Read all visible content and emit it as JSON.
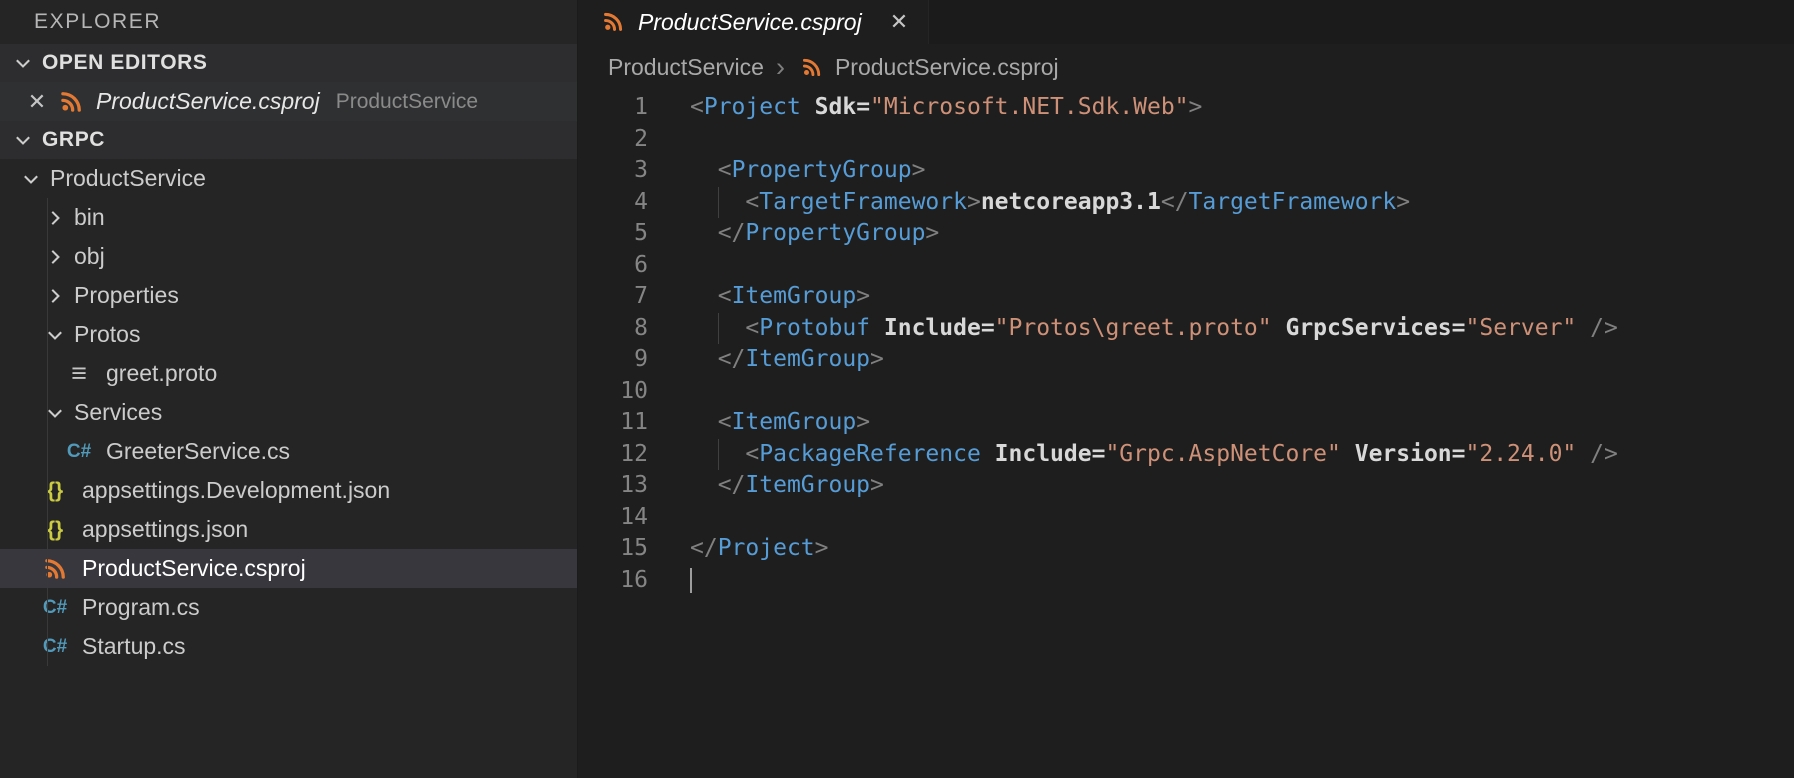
{
  "colors": {
    "accent_orange": "#e37933",
    "csharp_blue": "#519aba",
    "json_yellow": "#cbcb41",
    "tag_blue": "#569cd6",
    "string_orange": "#ce9178",
    "selection_bg": "#37373d"
  },
  "sidebar": {
    "title": "EXPLORER",
    "open_editors": {
      "header": "OPEN EDITORS",
      "items": [
        {
          "close": "✕",
          "icon": "csproj",
          "label": "ProductService.csproj",
          "description": "ProductService"
        }
      ]
    },
    "workspace": {
      "header": "GRPC",
      "tree": [
        {
          "label": "ProductService",
          "indent": 0,
          "kind": "folder",
          "expanded": true
        },
        {
          "label": "bin",
          "indent": 1,
          "kind": "folder",
          "expanded": false
        },
        {
          "label": "obj",
          "indent": 1,
          "kind": "folder",
          "expanded": false
        },
        {
          "label": "Properties",
          "indent": 1,
          "kind": "folder",
          "expanded": false
        },
        {
          "label": "Protos",
          "indent": 1,
          "kind": "folder",
          "expanded": true
        },
        {
          "label": "greet.proto",
          "indent": 2,
          "kind": "file",
          "icon": "proto"
        },
        {
          "label": "Services",
          "indent": 1,
          "kind": "folder",
          "expanded": true
        },
        {
          "label": "GreeterService.cs",
          "indent": 2,
          "kind": "file",
          "icon": "csharp"
        },
        {
          "label": "appsettings.Development.json",
          "indent": 1,
          "kind": "file",
          "icon": "json"
        },
        {
          "label": "appsettings.json",
          "indent": 1,
          "kind": "file",
          "icon": "json"
        },
        {
          "label": "ProductService.csproj",
          "indent": 1,
          "kind": "file",
          "icon": "csproj",
          "selected": true
        },
        {
          "label": "Program.cs",
          "indent": 1,
          "kind": "file",
          "icon": "csharp"
        },
        {
          "label": "Startup.cs",
          "indent": 1,
          "kind": "file",
          "icon": "csharp"
        }
      ]
    }
  },
  "editor": {
    "tab": {
      "label": "ProductService.csproj",
      "icon": "csproj",
      "close": "✕",
      "preview": true
    },
    "breadcrumb_separator": "›",
    "breadcrumb": [
      {
        "label": "ProductService"
      },
      {
        "label": "ProductService.csproj",
        "icon": "csproj"
      }
    ],
    "lines": [
      {
        "tokens": [
          [
            "p",
            "<"
          ],
          [
            "t",
            "Project"
          ],
          [
            "w",
            " "
          ],
          [
            "a",
            "Sdk="
          ],
          [
            "s",
            "\"Microsoft.NET.Sdk.Web\""
          ],
          [
            "p",
            ">"
          ]
        ]
      },
      {
        "tokens": []
      },
      {
        "tokens": [
          [
            "w",
            "  "
          ],
          [
            "p",
            "<"
          ],
          [
            "t",
            "PropertyGroup"
          ],
          [
            "p",
            ">"
          ]
        ]
      },
      {
        "guides": [
          2
        ],
        "tokens": [
          [
            "w",
            "    "
          ],
          [
            "p",
            "<"
          ],
          [
            "t",
            "TargetFramework"
          ],
          [
            "p",
            ">"
          ],
          [
            "x",
            "netcoreapp3.1"
          ],
          [
            "p",
            "</"
          ],
          [
            "t",
            "TargetFramework"
          ],
          [
            "p",
            ">"
          ]
        ]
      },
      {
        "tokens": [
          [
            "w",
            "  "
          ],
          [
            "p",
            "</"
          ],
          [
            "t",
            "PropertyGroup"
          ],
          [
            "p",
            ">"
          ]
        ]
      },
      {
        "tokens": []
      },
      {
        "tokens": [
          [
            "w",
            "  "
          ],
          [
            "p",
            "<"
          ],
          [
            "t",
            "ItemGroup"
          ],
          [
            "p",
            ">"
          ]
        ]
      },
      {
        "guides": [
          2
        ],
        "tokens": [
          [
            "w",
            "    "
          ],
          [
            "p",
            "<"
          ],
          [
            "t",
            "Protobuf"
          ],
          [
            "w",
            " "
          ],
          [
            "a",
            "Include="
          ],
          [
            "s",
            "\"Protos\\greet.proto\""
          ],
          [
            "w",
            " "
          ],
          [
            "a",
            "GrpcServices="
          ],
          [
            "s",
            "\"Server\""
          ],
          [
            "w",
            " "
          ],
          [
            "p",
            "/>"
          ]
        ]
      },
      {
        "tokens": [
          [
            "w",
            "  "
          ],
          [
            "p",
            "</"
          ],
          [
            "t",
            "ItemGroup"
          ],
          [
            "p",
            ">"
          ]
        ]
      },
      {
        "tokens": []
      },
      {
        "tokens": [
          [
            "w",
            "  "
          ],
          [
            "p",
            "<"
          ],
          [
            "t",
            "ItemGroup"
          ],
          [
            "p",
            ">"
          ]
        ]
      },
      {
        "guides": [
          2
        ],
        "tokens": [
          [
            "w",
            "    "
          ],
          [
            "p",
            "<"
          ],
          [
            "t",
            "PackageReference"
          ],
          [
            "w",
            " "
          ],
          [
            "a",
            "Include="
          ],
          [
            "s",
            "\"Grpc.AspNetCore\""
          ],
          [
            "w",
            " "
          ],
          [
            "a",
            "Version="
          ],
          [
            "s",
            "\"2.24.0\""
          ],
          [
            "w",
            " "
          ],
          [
            "p",
            "/>"
          ]
        ]
      },
      {
        "tokens": [
          [
            "w",
            "  "
          ],
          [
            "p",
            "</"
          ],
          [
            "t",
            "ItemGroup"
          ],
          [
            "p",
            ">"
          ]
        ]
      },
      {
        "tokens": []
      },
      {
        "tokens": [
          [
            "p",
            "</"
          ],
          [
            "t",
            "Project"
          ],
          [
            "p",
            ">"
          ]
        ]
      },
      {
        "cursor": true,
        "tokens": []
      }
    ]
  }
}
